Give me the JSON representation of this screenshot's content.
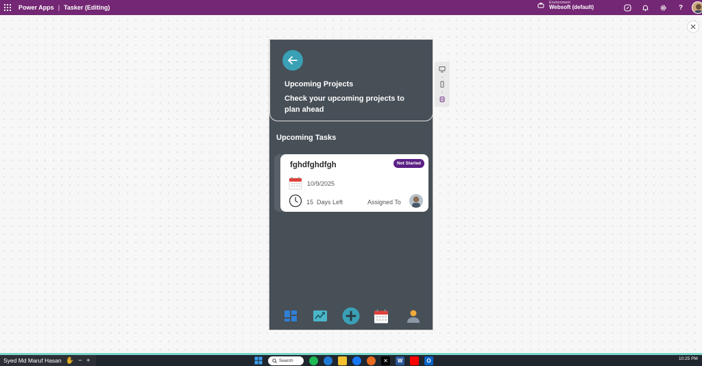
{
  "header": {
    "brand": "Power Apps",
    "separator": "|",
    "app_title": "Tasker (Editing)",
    "environment_label": "Environment",
    "environment_name": "Websoft (default)"
  },
  "hero": {
    "title": "Upcoming Projects",
    "subtitle": "Check your upcoming projects to plan ahead"
  },
  "section": {
    "title": "Upcoming Tasks"
  },
  "task": {
    "name": "fghdfghdfgh",
    "status": "Not Started",
    "date": "10/9/2025",
    "days_left_number": "15",
    "days_left_label": "Days Left",
    "assigned_to_label": "Assigned To"
  },
  "bottom_nav": [
    {
      "name": "dashboard-icon"
    },
    {
      "name": "analytics-icon"
    },
    {
      "name": "add-icon"
    },
    {
      "name": "calendar-icon"
    },
    {
      "name": "profile-icon"
    }
  ],
  "taskbar": {
    "user_name": "Syed Md Maruf Hasan",
    "search_label": "Search",
    "time": "10:25 PM"
  },
  "colors": {
    "header": "#742774",
    "phone_bg": "#474f57",
    "accent": "#3aa0b5",
    "badge": "#5a1f84"
  }
}
